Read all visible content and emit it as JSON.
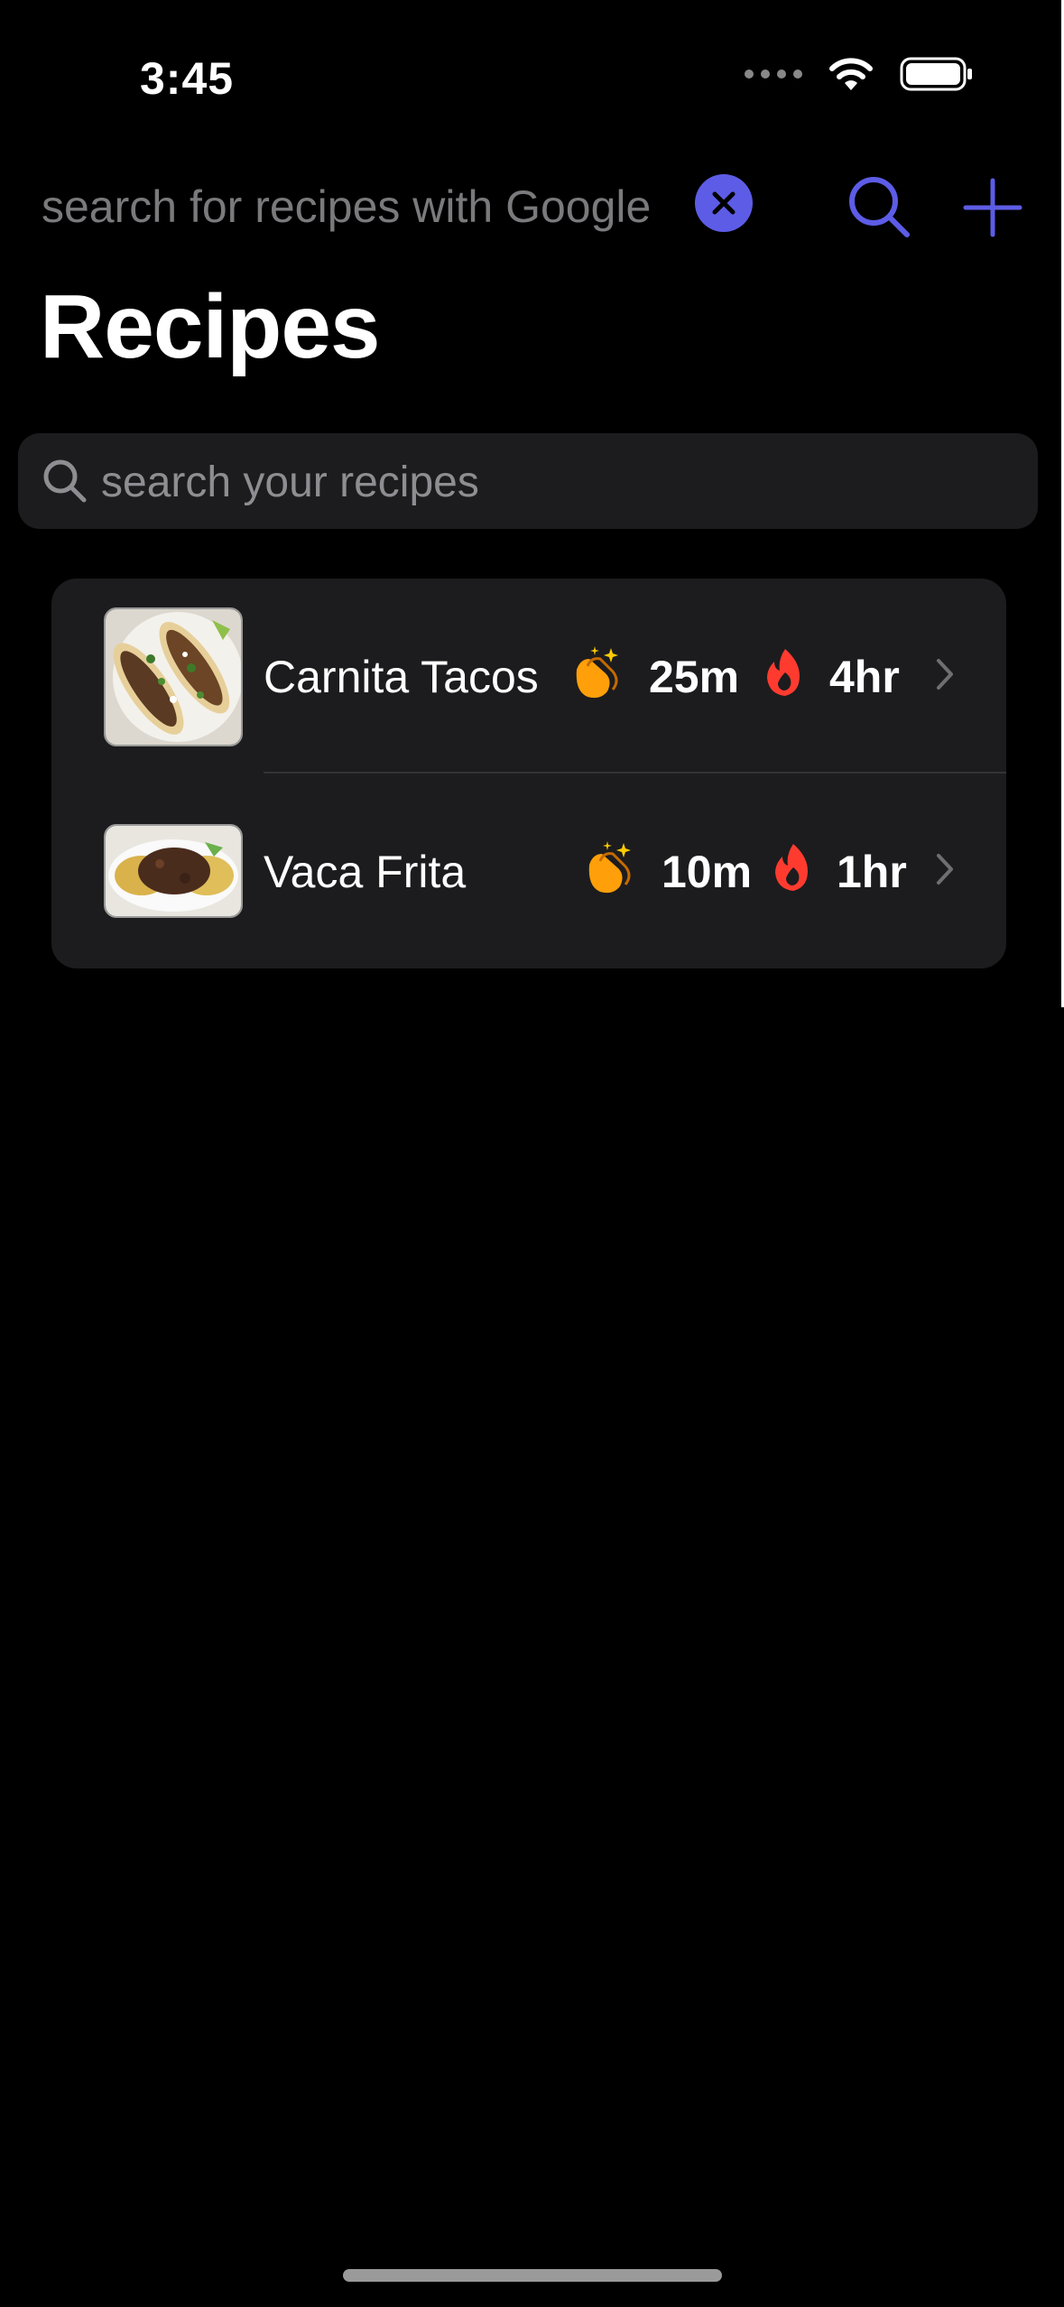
{
  "status_bar": {
    "time": "3:45"
  },
  "web_search": {
    "placeholder": "search for recipes with Google"
  },
  "header": {
    "title": "Recipes"
  },
  "local_search": {
    "placeholder": "search your recipes"
  },
  "recipes": [
    {
      "name": "Carnita Tacos",
      "prep_time": "25m",
      "cook_time": "4hr"
    },
    {
      "name": "Vaca Frita",
      "prep_time": "10m",
      "cook_time": "1hr"
    }
  ],
  "colors": {
    "accent": "#5d5ce6",
    "clap": "#ff9f0a",
    "fire": "#ff3b30",
    "cell": "#1c1c1e"
  },
  "icons": {
    "clear": "xmark-circle-icon",
    "search": "magnifying-glass-icon",
    "add": "plus-icon",
    "prep": "clapping-hands-icon",
    "cook": "flame-icon",
    "chevron": "chevron-right-icon"
  }
}
